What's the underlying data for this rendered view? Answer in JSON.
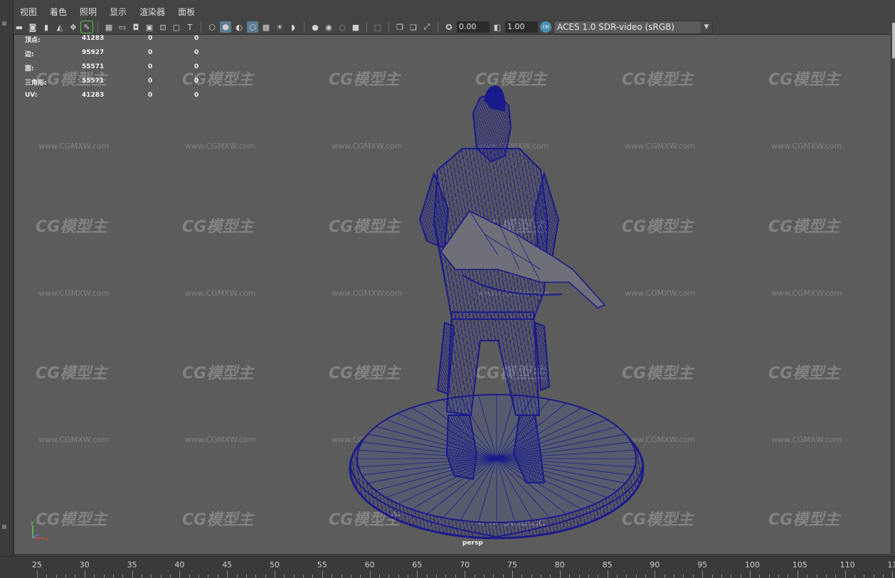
{
  "menubar": {
    "items": [
      "视图",
      "着色",
      "照明",
      "显示",
      "渲染器",
      "面板"
    ]
  },
  "toolbar": {
    "exposure_value": "0.00",
    "gamma_value": "1.00",
    "csm_badge": "CM",
    "color_space": "ACES 1.0 SDR-video (sRGB)"
  },
  "hud": {
    "rows": [
      {
        "label": "顶点:",
        "values": [
          "41283",
          "0",
          "0"
        ]
      },
      {
        "label": "边:",
        "values": [
          "95927",
          "0",
          "0"
        ]
      },
      {
        "label": "面:",
        "values": [
          "55571",
          "0",
          "0"
        ]
      },
      {
        "label": "三角形:",
        "values": [
          "55571",
          "0",
          "0"
        ]
      },
      {
        "label": "UV:",
        "values": [
          "41283",
          "0",
          "0"
        ]
      }
    ]
  },
  "viewport": {
    "camera_label": "persp",
    "watermark_logo": "CG模型主",
    "watermark_url": "www.CGMXW.com",
    "axis_labels": {
      "y": "y",
      "x": "x",
      "z": "z"
    }
  },
  "timeline": {
    "ticks": [
      "25",
      "30",
      "35",
      "40",
      "45",
      "50",
      "55",
      "60",
      "65",
      "70",
      "75",
      "80",
      "85",
      "90",
      "95",
      "100",
      "105",
      "110",
      "11"
    ]
  },
  "colors": {
    "wireframe": "#1a1a8c",
    "viewport_bg": "#5c5c5c",
    "active_button": "#5a7d92",
    "accent_green": "#57c24a"
  }
}
